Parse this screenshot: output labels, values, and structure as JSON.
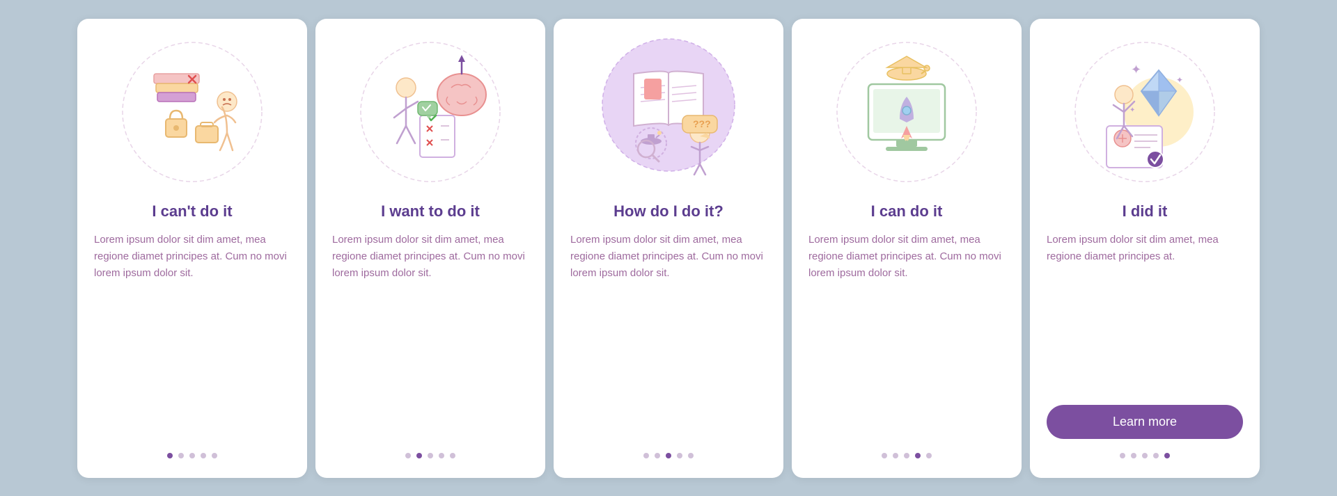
{
  "cards": [
    {
      "id": "card-1",
      "title": "I can't do it",
      "body": "Lorem ipsum dolor sit dim amet, mea regione diamet principes at. Cum no movi lorem ipsum dolor sit.",
      "dots": [
        true,
        false,
        false,
        false,
        false
      ],
      "button": null,
      "illustration": "cant-do-it"
    },
    {
      "id": "card-2",
      "title": "I want to do it",
      "body": "Lorem ipsum dolor sit dim amet, mea regione diamet principes at. Cum no movi lorem ipsum dolor sit.",
      "dots": [
        false,
        true,
        false,
        false,
        false
      ],
      "button": null,
      "illustration": "want-to-do-it"
    },
    {
      "id": "card-3",
      "title": "How do I do it?",
      "body": "Lorem ipsum dolor sit dim amet, mea regione diamet principes at. Cum no movi lorem ipsum dolor sit.",
      "dots": [
        false,
        false,
        true,
        false,
        false
      ],
      "button": null,
      "illustration": "how-do-i-do-it"
    },
    {
      "id": "card-4",
      "title": "I can do it",
      "body": "Lorem ipsum dolor sit dim amet, mea regione diamet principes at. Cum no movi lorem ipsum dolor sit.",
      "dots": [
        false,
        false,
        false,
        true,
        false
      ],
      "button": null,
      "illustration": "can-do-it"
    },
    {
      "id": "card-5",
      "title": "I did it",
      "body": "Lorem ipsum dolor sit dim amet, mea regione diamet principes at.",
      "dots": [
        false,
        false,
        false,
        false,
        true
      ],
      "button": "Learn more",
      "illustration": "did-it"
    }
  ]
}
